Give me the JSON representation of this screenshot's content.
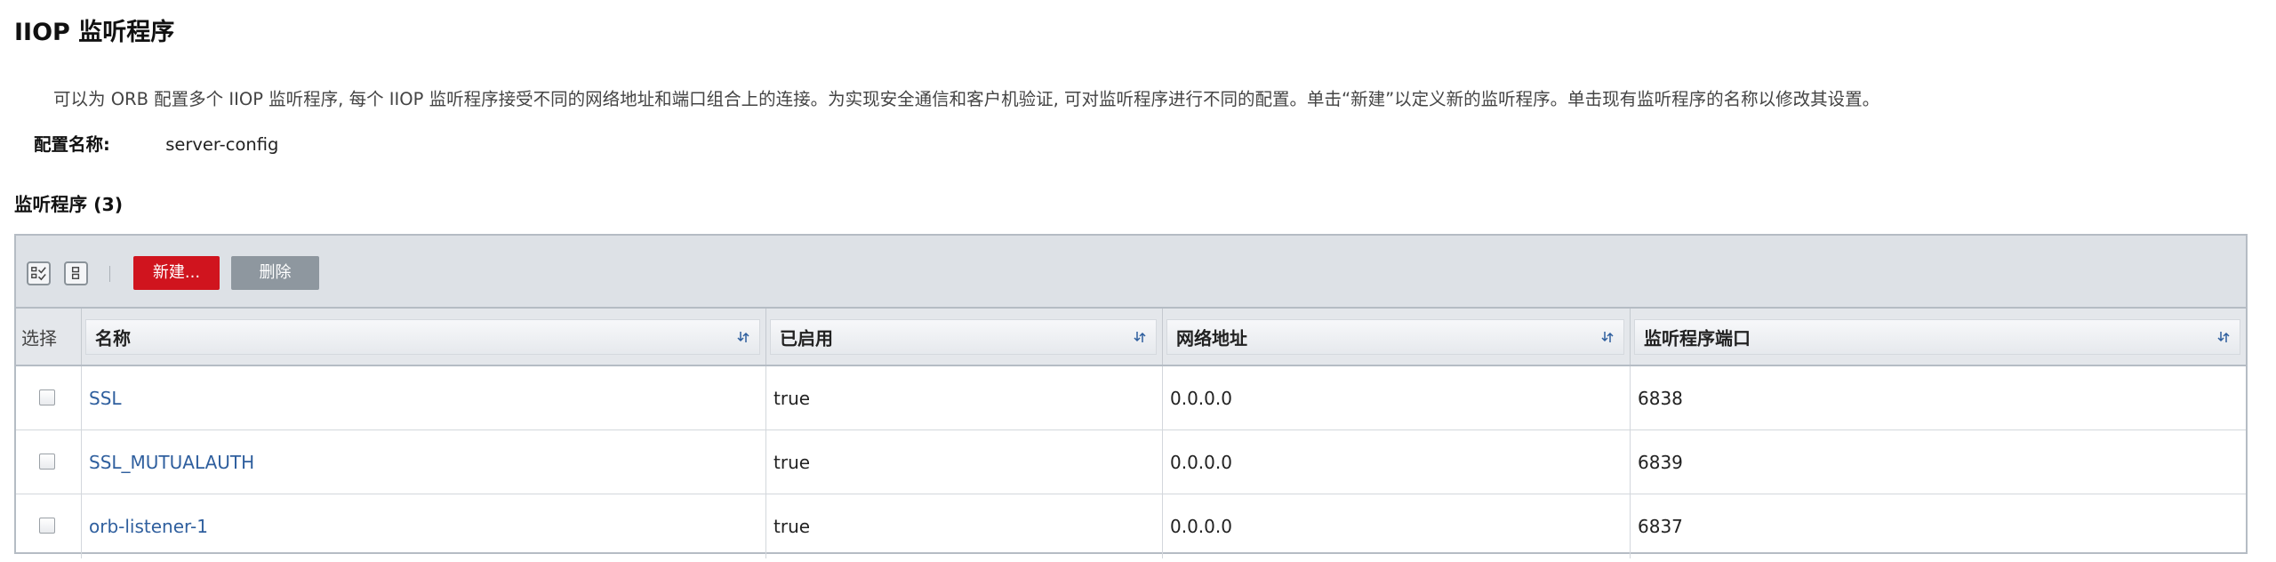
{
  "page": {
    "title": "IIOP 监听程序",
    "description": "可以为 ORB 配置多个 IIOP 监听程序, 每个 IIOP 监听程序接受不同的网络地址和端口组合上的连接。为实现安全通信和客户机验证, 可对监听程序进行不同的配置。单击“新建”以定义新的监听程序。单击现有监听程序的名称以修改其设置。",
    "config_label": "配置名称:",
    "config_value": "server-config"
  },
  "listeners": {
    "section_title": "监听程序 (3)",
    "toolbar": {
      "icons": [
        "select-all-icon",
        "deselect-all-icon"
      ],
      "new_label": "新建...",
      "delete_label": "删除"
    },
    "columns": {
      "select": "选择",
      "name": "名称",
      "enabled": "已启用",
      "address": "网络地址",
      "port": "监听程序端口"
    },
    "rows": [
      {
        "name": "SSL",
        "enabled": "true",
        "address": "0.0.0.0",
        "port": "6838"
      },
      {
        "name": "SSL_MUTUALAUTH",
        "enabled": "true",
        "address": "0.0.0.0",
        "port": "6839"
      },
      {
        "name": "orb-listener-1",
        "enabled": "true",
        "address": "0.0.0.0",
        "port": "6837"
      }
    ]
  },
  "colors": {
    "new_button": "#d0141e",
    "delete_button": "#8e979f",
    "link": "#2f5f9e",
    "toolbar_bg": "#dde1e6"
  }
}
